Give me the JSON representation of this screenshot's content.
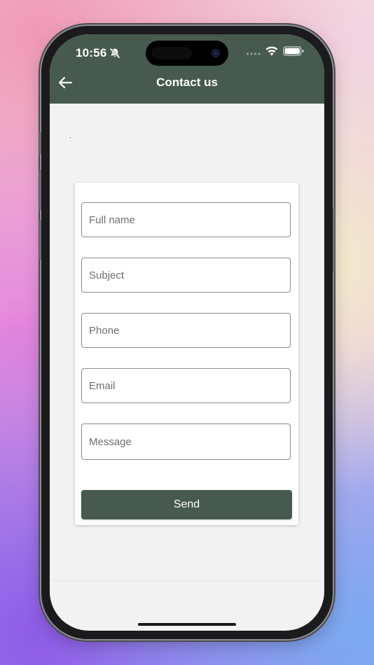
{
  "status_bar": {
    "time": "10:56"
  },
  "header": {
    "title": "Contact us",
    "color": "#465a4f"
  },
  "form": {
    "full_name_placeholder": "Full name",
    "subject_placeholder": "Subject",
    "phone_placeholder": "Phone",
    "email_placeholder": "Email",
    "message_placeholder": "Message",
    "send_label": "Send"
  },
  "icons": {
    "back": "arrow-left-icon",
    "bell": "bell-slash-icon",
    "signal": "cellular-signal-icon",
    "wifi": "wifi-icon",
    "battery": "battery-icon"
  }
}
